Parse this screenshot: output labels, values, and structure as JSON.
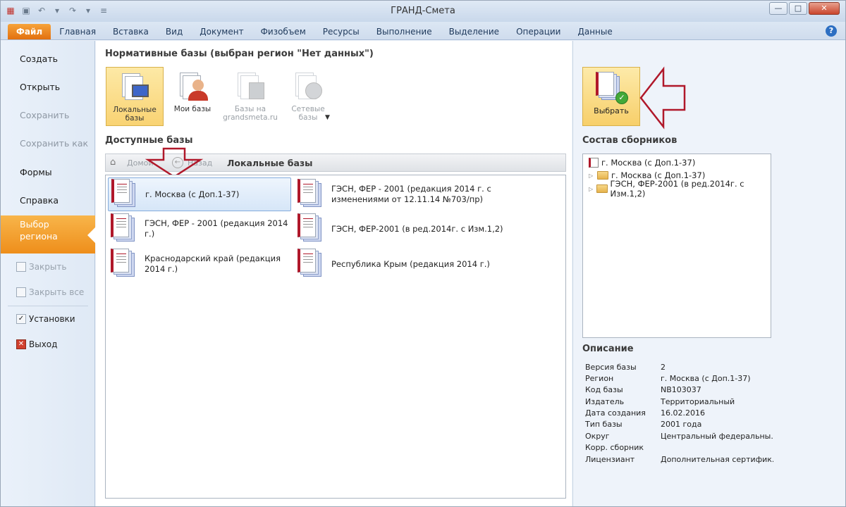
{
  "window": {
    "title": "ГРАНД-Смета"
  },
  "ribbon": {
    "tabs": [
      "Файл",
      "Главная",
      "Вставка",
      "Вид",
      "Документ",
      "Физобъем",
      "Ресурсы",
      "Выполнение",
      "Выделение",
      "Операции",
      "Данные"
    ]
  },
  "leftnav": {
    "create": "Создать",
    "open": "Открыть",
    "save": "Сохранить",
    "save_as": "Сохранить как",
    "forms": "Формы",
    "help": "Справка",
    "region_line1": "Выбор",
    "region_line2": "региона",
    "close": "Закрыть",
    "close_all": "Закрыть все",
    "settings": "Установки",
    "exit": "Выход"
  },
  "center": {
    "normative_title": "Нормативные базы (выбран регион \"Нет данных\")",
    "sources": [
      {
        "line1": "Локальные",
        "line2": "базы"
      },
      {
        "line1": "Мои базы",
        "line2": ""
      },
      {
        "line1": "Базы на",
        "line2": "grandsmeta.ru"
      },
      {
        "line1": "Сетевые",
        "line2": "базы"
      }
    ],
    "available_title": "Доступные базы",
    "nav_home": "Домой",
    "nav_back": "Назад",
    "nav_current": "Локальные базы",
    "bases": [
      {
        "line1": "г. Москва (с Доп.1-37)",
        "line2": ""
      },
      {
        "line1": "ГЭСН, ФЕР - 2001 (редакция 2014 г. с",
        "line2": "изменениями от 12.11.14 №703/пр)"
      },
      {
        "line1": "ГЭСН, ФЕР - 2001 (редакция 2014 г.)",
        "line2": ""
      },
      {
        "line1": "ГЭСН, ФЕР-2001 (в ред.2014г. с Изм.1,2)",
        "line2": ""
      },
      {
        "line1": "Краснодарский край (редакция 2014 г.)",
        "line2": ""
      },
      {
        "line1": "Республика Крым (редакция 2014 г.)",
        "line2": ""
      }
    ]
  },
  "right": {
    "select_label": "Выбрать",
    "composition_title": "Состав сборников",
    "tree": [
      "г. Москва (с Доп.1-37)",
      "г. Москва (с Доп.1-37)",
      "ГЭСН, ФЕР-2001 (в ред.2014г. с Изм.1,2)"
    ],
    "description_title": "Описание",
    "description": [
      {
        "k": "Версия базы",
        "v": "2"
      },
      {
        "k": "Регион",
        "v": "г. Москва (с Доп.1-37)"
      },
      {
        "k": "Код базы",
        "v": "NB103037"
      },
      {
        "k": "Издатель",
        "v": "Территориальный"
      },
      {
        "k": "Дата создания",
        "v": "16.02.2016"
      },
      {
        "k": "Тип базы",
        "v": "2001 года"
      },
      {
        "k": "Округ",
        "v": "Центральный федеральны..."
      },
      {
        "k": "Корр. сборник",
        "v": ""
      },
      {
        "k": "Лицензиант",
        "v": "Дополнительная сертифик..."
      }
    ]
  },
  "colors": {
    "accent": "#f0951f",
    "arrow": "#b0182a",
    "selected": "#f9d373"
  }
}
